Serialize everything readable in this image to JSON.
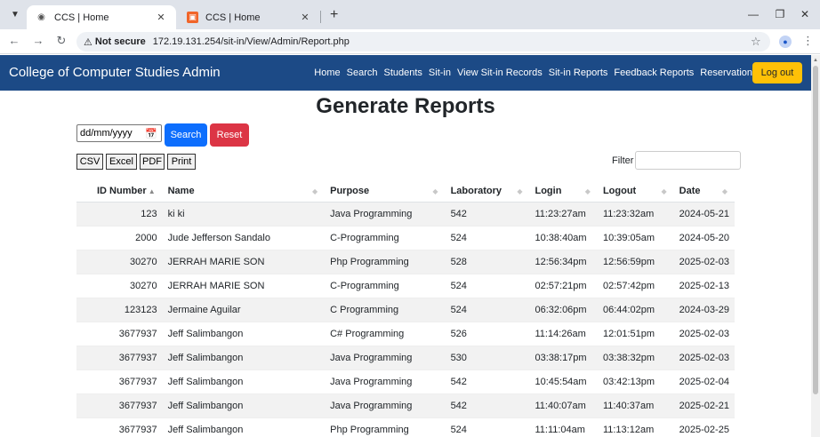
{
  "browser": {
    "tabs": [
      {
        "title": "CCS | Home",
        "active": true
      },
      {
        "title": "CCS | Home",
        "active": false
      }
    ],
    "address": {
      "security_label": "Not secure",
      "url": "172.19.131.254/sit-in/View/Admin/Report.php"
    }
  },
  "navbar": {
    "brand": "College of Computer Studies Admin",
    "links": [
      "Home",
      "Search",
      "Students",
      "Sit-in",
      "View Sit-in Records",
      "Sit-in Reports",
      "Feedback Reports",
      "Reservation"
    ],
    "logout_label": "Log out",
    "colors": {
      "bar": "#1c4a86",
      "logout": "#ffc107"
    }
  },
  "page": {
    "title": "Generate Reports",
    "date_input_value": "dd/mm/yyyy",
    "search_label": "Search",
    "reset_label": "Reset",
    "export_buttons": [
      "CSV",
      "Excel",
      "PDF",
      "Print"
    ],
    "filter_label": "Filter"
  },
  "table": {
    "headers": [
      "ID Number",
      "Name",
      "Purpose",
      "Laboratory",
      "Login",
      "Logout",
      "Date"
    ],
    "rows": [
      [
        "123",
        "ki ki",
        "Java Programming",
        "542",
        "11:23:27am",
        "11:23:32am",
        "2024-05-21"
      ],
      [
        "2000",
        "Jude Jefferson Sandalo",
        "C-Programming",
        "524",
        "10:38:40am",
        "10:39:05am",
        "2024-05-20"
      ],
      [
        "30270",
        "JERRAH MARIE SON",
        "Php Programming",
        "528",
        "12:56:34pm",
        "12:56:59pm",
        "2025-02-03"
      ],
      [
        "30270",
        "JERRAH MARIE SON",
        "C-Programming",
        "524",
        "02:57:21pm",
        "02:57:42pm",
        "2025-02-13"
      ],
      [
        "123123",
        "Jermaine Aguilar",
        "C Programming",
        "524",
        "06:32:06pm",
        "06:44:02pm",
        "2024-03-29"
      ],
      [
        "3677937",
        "Jeff Salimbangon",
        "C# Programming",
        "526",
        "11:14:26am",
        "12:01:51pm",
        "2025-02-03"
      ],
      [
        "3677937",
        "Jeff Salimbangon",
        "Java Programming",
        "530",
        "03:38:17pm",
        "03:38:32pm",
        "2025-02-03"
      ],
      [
        "3677937",
        "Jeff Salimbangon",
        "Java Programming",
        "542",
        "10:45:54am",
        "03:42:13pm",
        "2025-02-04"
      ],
      [
        "3677937",
        "Jeff Salimbangon",
        "Java Programming",
        "542",
        "11:40:07am",
        "11:40:37am",
        "2025-02-21"
      ],
      [
        "3677937",
        "Jeff Salimbangon",
        "Php Programming",
        "524",
        "11:11:04am",
        "11:13:12am",
        "2025-02-25"
      ]
    ]
  },
  "icons": {
    "tab_menu": "chevron-down-icon",
    "tab_favicon": "chrome-icon",
    "close": "close-icon",
    "warning": "warning-icon",
    "calendar": "calendar-icon",
    "star": "star-icon",
    "sort": "sort-arrows-icon"
  }
}
